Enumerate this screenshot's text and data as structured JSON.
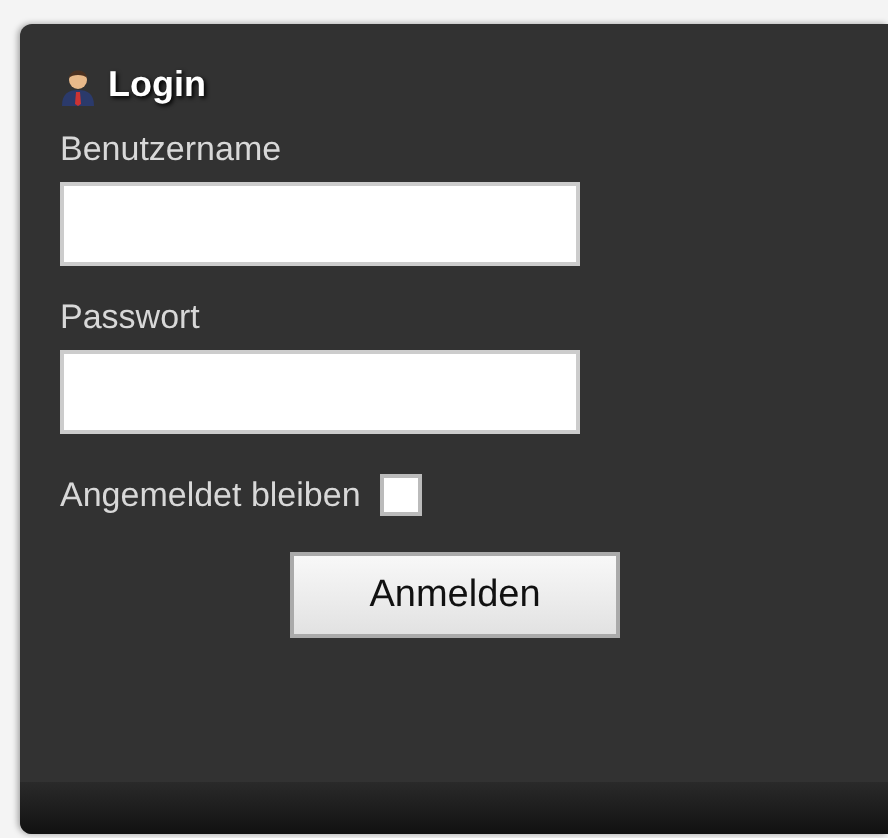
{
  "panel": {
    "title": "Login"
  },
  "fields": [
    {
      "label": "Benutzername"
    },
    {
      "label": "Passwort"
    }
  ],
  "remember": {
    "label": "Angemeldet bleiben",
    "checked": false
  },
  "submit": {
    "label": "Anmelden"
  }
}
